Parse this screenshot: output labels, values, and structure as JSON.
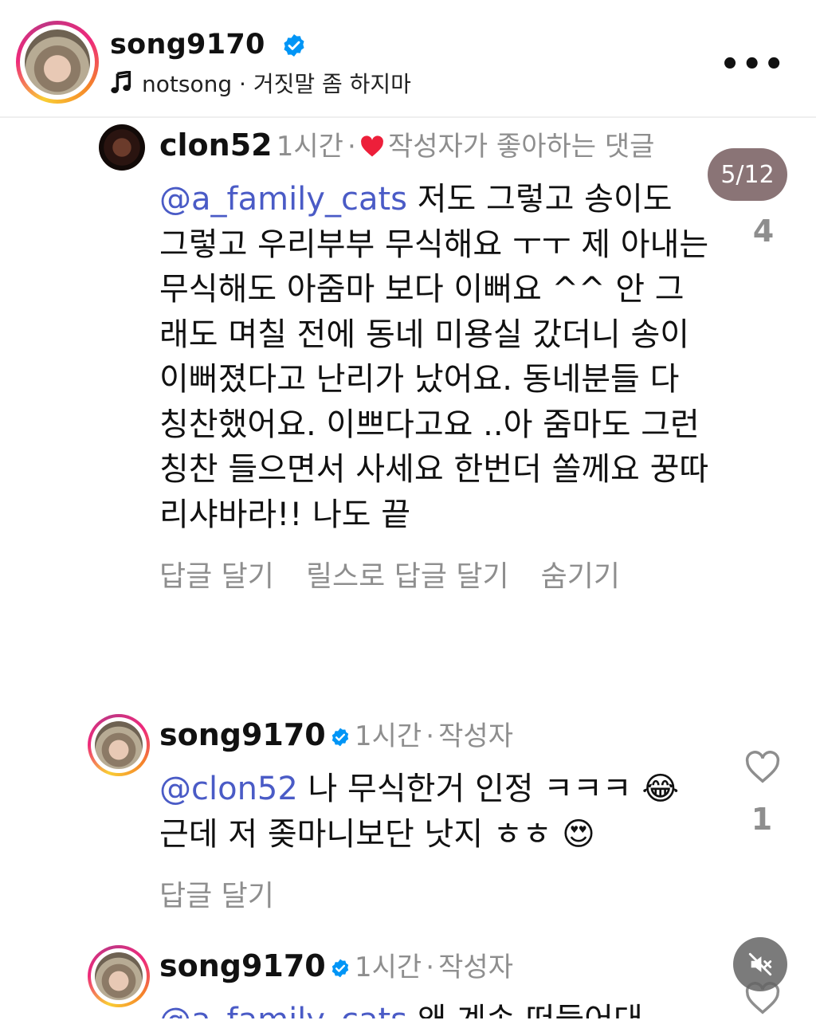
{
  "header": {
    "username": "song9170",
    "music_artist": "notsong",
    "music_separator": "·",
    "music_title": "거짓말 좀 하지마",
    "more_label": "•••"
  },
  "comments": [
    {
      "username": "clon52",
      "time": "1시간",
      "dot": "·",
      "liked_by_author": "작성자가 좋아하는 댓글",
      "mention": "@a_family_cats",
      "text": " 저도 그렇고 송이도 그렇고 우리부부 무식해요 ㅜㅜ 제 아내는 무식해도 아줌마 보다 이뻐요 ^^ 안 그래도 며칠 전에 동네 미용실 갔더니 송이 이뻐졌다고 난리가 났어요. 동네분들 다 칭찬했어요. 이쁘다고요 ..아 줌마도 그런 칭찬 들으면서 사세요  한번더 쏠께요 꿍따리샤바라!! 나도 끝",
      "like_count": "4",
      "actions": [
        "답글 달기",
        "릴스로 답글 달기",
        "숨기기"
      ]
    },
    {
      "username": "song9170",
      "time": "1시간",
      "dot": "·",
      "role": "작성자",
      "mention": "@clon52",
      "text": " 나 무식한거 인정 ㅋㅋㅋ 😂 근데 저 좆마니보단 낫지 ㅎㅎ 😍",
      "like_count": "1",
      "actions": [
        "답글 달기"
      ]
    },
    {
      "username": "song9170",
      "time": "1시간",
      "dot": "·",
      "role": "작성자",
      "mention": "@a_family_cats",
      "text": " 왜 계속 떠들어대"
    }
  ],
  "pager": "5/12",
  "colors": {
    "mention": "#4a5bc6",
    "meta": "#8e8e8e",
    "verified": "#0095f6",
    "pill": "#8a7476",
    "heart": "#ed1f3a"
  },
  "icons": {
    "verified": "verified-badge-icon",
    "music": "music-note-icon",
    "heart": "heart-icon",
    "mute": "mute-icon"
  }
}
